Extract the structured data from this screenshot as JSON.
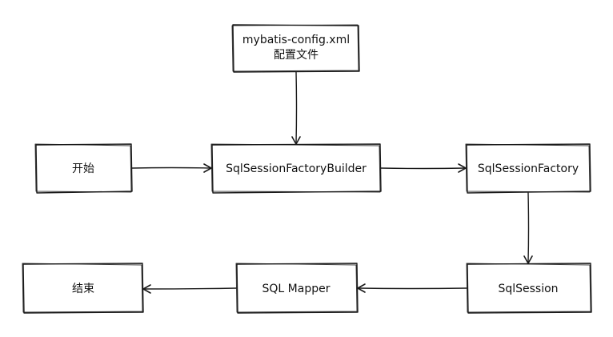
{
  "nodes": {
    "config": {
      "line1": "mybatis-config.xml",
      "line2": "配置文件"
    },
    "start": {
      "label": "开始"
    },
    "builder": {
      "label": "SqlSessionFactoryBuilder"
    },
    "factory": {
      "label": "SqlSessionFactory"
    },
    "session": {
      "label": "SqlSession"
    },
    "mapper": {
      "label": "SQL Mapper"
    },
    "end": {
      "label": "结束"
    }
  }
}
